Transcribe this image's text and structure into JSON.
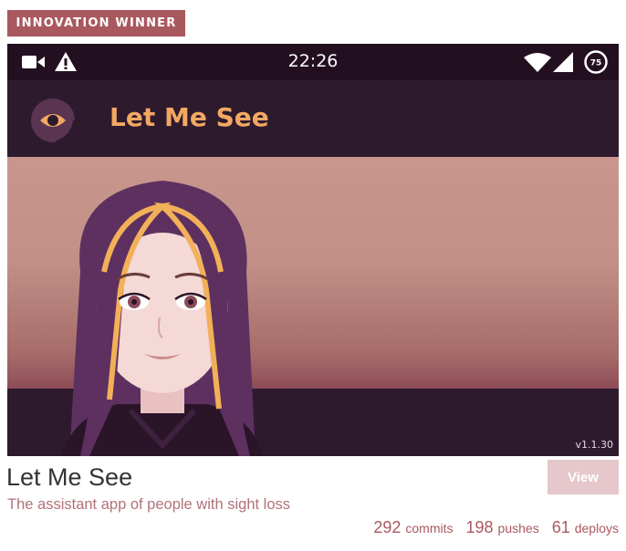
{
  "badge": {
    "label": "INNOVATION WINNER"
  },
  "phone": {
    "status_time": "22:26",
    "battery_level": "75",
    "app_title": "Let Me See",
    "version": "v1.1.30",
    "icons": [
      "video-camera-icon",
      "warning-icon",
      "wifi-icon",
      "signal-icon",
      "battery-icon"
    ]
  },
  "project": {
    "name": "Let Me See",
    "description": "The assistant app of people with sight loss",
    "view_label": "View"
  },
  "stats": [
    {
      "value": "292",
      "label": "commits"
    },
    {
      "value": "198",
      "label": "pushes"
    },
    {
      "value": "61",
      "label": "deploys"
    }
  ],
  "colors": {
    "accent": "#a9585e",
    "app_title": "#f2a862",
    "app_bg": "#2e1a2d",
    "view_button": "#e6c7cb"
  }
}
